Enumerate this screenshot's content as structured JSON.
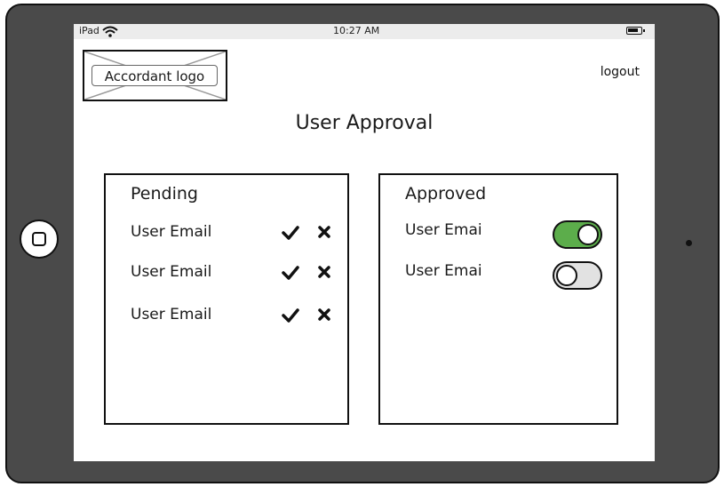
{
  "status_bar": {
    "carrier": "iPad",
    "time": "10:27 AM"
  },
  "header": {
    "logo_text": "Accordant logo",
    "logout": "logout"
  },
  "page": {
    "title": "User Approval"
  },
  "pending": {
    "heading": "Pending",
    "items": [
      {
        "email": "User Email"
      },
      {
        "email": "User Email"
      },
      {
        "email": "User Email"
      }
    ]
  },
  "approved": {
    "heading": "Approved",
    "items": [
      {
        "email": "User Emai",
        "enabled": true
      },
      {
        "email": "User Emai",
        "enabled": false
      }
    ]
  },
  "colors": {
    "toggle_on": "#5cad4b",
    "toggle_off": "#e2e2e2"
  },
  "icons": {
    "approve": "checkmark-icon",
    "reject": "x-icon",
    "wifi": "wifi-icon",
    "battery": "battery-icon",
    "home": "home-button-icon"
  }
}
